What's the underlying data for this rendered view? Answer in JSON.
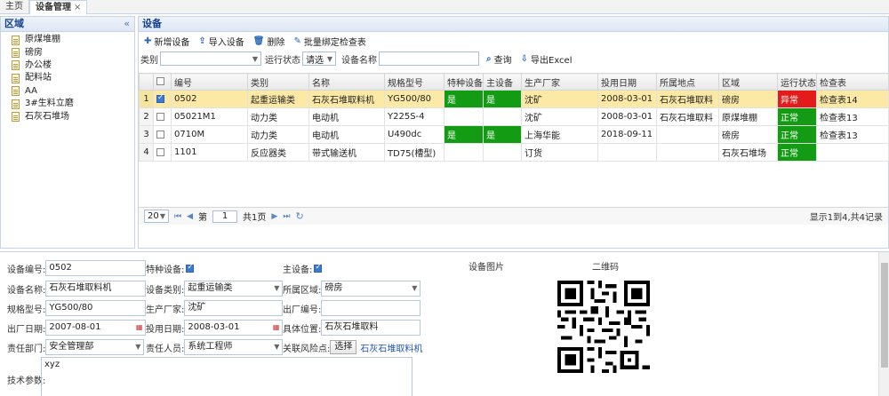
{
  "tabs": [
    {
      "label": "主页"
    },
    {
      "label": "设备管理",
      "close": "×"
    }
  ],
  "left_panel": {
    "title": "区域",
    "collapse": "«",
    "items": [
      "原煤堆棚",
      "磅房",
      "办公楼",
      "配料站",
      "AA",
      "3#生料立磨",
      "石灰石堆场"
    ]
  },
  "right_panel": {
    "title": "设备",
    "toolbar": {
      "add": "新增设备",
      "import": "导入设备",
      "delete": "删除",
      "bind": "批量绑定检查表"
    },
    "filter": {
      "category_label": "类别",
      "status_label": "运行状态",
      "status_value": "请选",
      "name_label": "设备名称",
      "query": "查询",
      "export": "导出Excel"
    },
    "columns": [
      "编号",
      "类别",
      "名称",
      "规格型号",
      "特种设备",
      "主设备",
      "生产厂家",
      "投用日期",
      "所属地点",
      "区域",
      "运行状态",
      "检查表"
    ],
    "rows": [
      {
        "num": "1",
        "checked": true,
        "code": "0502",
        "category": "起重运输类",
        "name": "石灰石堆取料机",
        "model": "YG500/80",
        "special": "是",
        "main": "是",
        "maker": "沈矿",
        "date": "2008-03-01",
        "location": "石灰石堆取料",
        "area": "磅房",
        "status": "异常",
        "status_color": "red",
        "sheet": "检查表14"
      },
      {
        "num": "2",
        "checked": false,
        "code": "05021M1",
        "category": "动力类",
        "name": "电动机",
        "model": "Y225S-4",
        "special": "",
        "main": "",
        "maker": "沈矿",
        "date": "2008-03-01",
        "location": "石灰石堆取料",
        "area": "原煤堆棚",
        "status": "正常",
        "status_color": "green",
        "sheet": "检查表13"
      },
      {
        "num": "3",
        "checked": false,
        "code": "0710M",
        "category": "动力类",
        "name": "电动机",
        "model": "U490dc",
        "special": "是",
        "main": "是",
        "maker": "上海华能",
        "date": "2018-09-11",
        "location": "",
        "area": "磅房",
        "status": "正常",
        "status_color": "green",
        "sheet": "检查表13"
      },
      {
        "num": "4",
        "checked": false,
        "code": "1101",
        "category": "反应器类",
        "name": "带式输送机",
        "model": "TD75(槽型)",
        "special": "",
        "main": "",
        "maker": "订货",
        "date": "",
        "location": "",
        "area": "石灰石堆场",
        "status": "正常",
        "status_color": "green",
        "sheet": ""
      }
    ],
    "pager": {
      "page_size": "20",
      "page_prefix": "第",
      "page": "1",
      "page_suffix": "共1页",
      "info": "显示1到4,共4记录"
    }
  },
  "form": {
    "code_label": "设备编号:",
    "code": "0502",
    "special_label": "特种设备:",
    "main_label": "主设备:",
    "image_label": "设备图片",
    "qr_label": "二维码",
    "name_label": "设备名称:",
    "name": "石灰石堆取料机",
    "category_label": "设备类别:",
    "category": "起重运输类",
    "area_label": "所属区域:",
    "area": "磅房",
    "model_label": "规格型号:",
    "model": "YG500/80",
    "maker_label": "生产厂家:",
    "maker": "沈矿",
    "serial_label": "出厂编号:",
    "serial": "",
    "factory_date_label": "出厂日期:",
    "factory_date": "2007-08-01",
    "use_date_label": "投用日期:",
    "use_date": "2008-03-01",
    "position_label": "具体位置:",
    "position": "石灰石堆取料",
    "dept_label": "责任部门:",
    "dept": "安全管理部",
    "person_label": "责任人员:",
    "person": "系统工程师",
    "risk_label": "关联风险点:",
    "risk_button": "选择",
    "risk_value": "石灰石堆取料机",
    "tech_label": "技术参数:",
    "tech": "xyz"
  },
  "colors": {
    "header": "#15428b",
    "selected_row": "#fce9a6",
    "normal": "#149b14",
    "abnormal": "#e21b1b",
    "accent": "#2a6ab8"
  }
}
